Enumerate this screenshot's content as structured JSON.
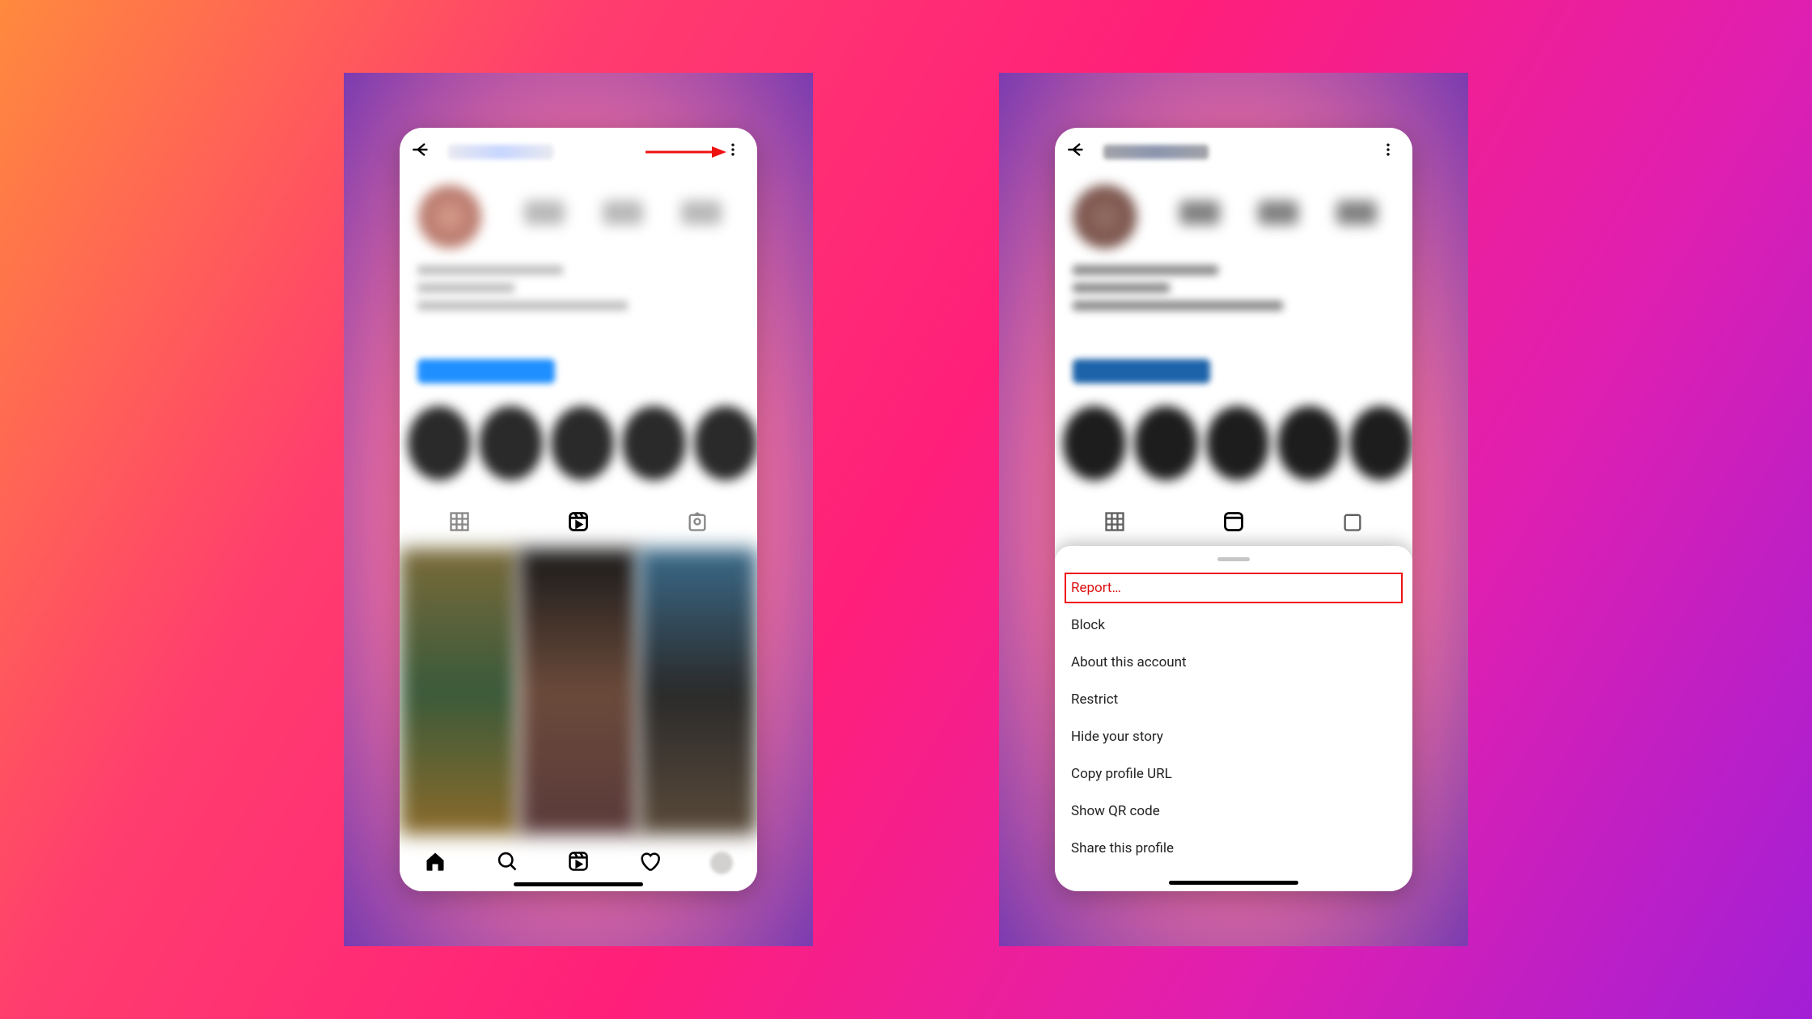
{
  "left_phone": {
    "annotation": {
      "arrow": true,
      "arrow_color": "#e11"
    },
    "tabs": {
      "grid": "grid-icon",
      "reels": "reels-icon",
      "tagged": "tagged-icon",
      "active": "reels"
    },
    "bottom_nav": [
      "home",
      "search",
      "reels",
      "activity",
      "profile"
    ]
  },
  "right_phone": {
    "menu_items": [
      {
        "label": "Report…",
        "highlighted": true
      },
      {
        "label": "Block",
        "highlighted": false
      },
      {
        "label": "About this account",
        "highlighted": false
      },
      {
        "label": "Restrict",
        "highlighted": false
      },
      {
        "label": "Hide your story",
        "highlighted": false
      },
      {
        "label": "Copy profile URL",
        "highlighted": false
      },
      {
        "label": "Show QR code",
        "highlighted": false
      },
      {
        "label": "Share this profile",
        "highlighted": false
      }
    ]
  }
}
